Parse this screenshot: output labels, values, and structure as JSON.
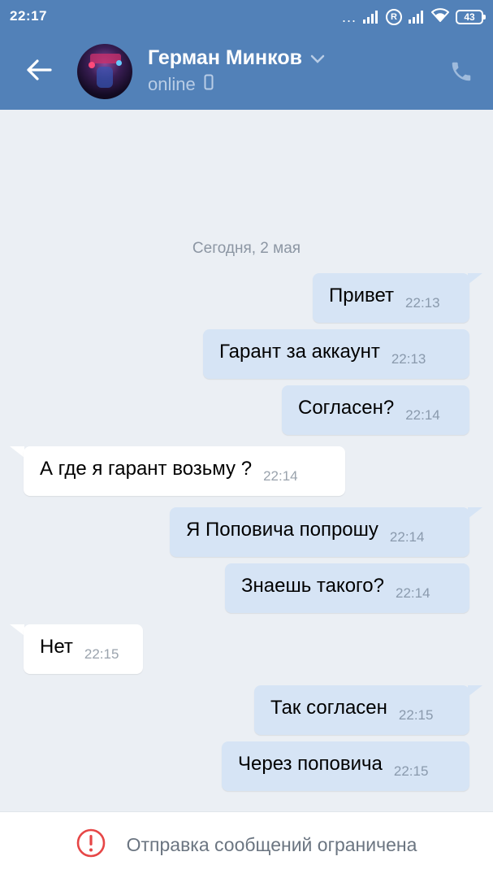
{
  "status_bar": {
    "time": "22:17",
    "dots": "...",
    "r_badge": "R",
    "battery": "43"
  },
  "header": {
    "name": "Герман Минков",
    "status": "online"
  },
  "chat": {
    "date_separator": "Сегодня, 2 мая",
    "messages": [
      {
        "direction": "out",
        "text": "Привет",
        "time": "22:13"
      },
      {
        "direction": "out",
        "text": "Гарант за аккаунт",
        "time": "22:13"
      },
      {
        "direction": "out",
        "text": "Согласен?",
        "time": "22:14"
      },
      {
        "direction": "in",
        "text": "А где я гарант возьму ?",
        "time": "22:14"
      },
      {
        "direction": "out",
        "text": "Я Поповича попрошу",
        "time": "22:14"
      },
      {
        "direction": "out",
        "text": "Знаешь такого?",
        "time": "22:14"
      },
      {
        "direction": "in",
        "text": "Нет",
        "time": "22:15"
      },
      {
        "direction": "out",
        "text": "Так согласен",
        "time": "22:15"
      },
      {
        "direction": "out",
        "text": "Через поповича",
        "time": "22:15"
      }
    ]
  },
  "footer": {
    "restriction_text": "Отправка сообщений ограничена"
  },
  "colors": {
    "header_bg": "#5281b8",
    "chat_bg": "#ebeff4",
    "outgoing_bubble": "#d6e4f5",
    "incoming_bubble": "#ffffff",
    "warning_red": "#e64646"
  }
}
